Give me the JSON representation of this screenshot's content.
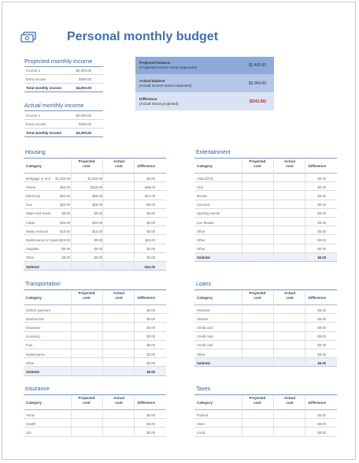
{
  "title": "Personal monthly budget",
  "projected_income": {
    "heading": "Projected monthly income",
    "rows": [
      {
        "label": "Income 1",
        "value": "$4,300.00"
      },
      {
        "label": "Extra income",
        "value": "$300.00"
      }
    ],
    "total": {
      "label": "Total monthly income",
      "value": "$4,600.00"
    }
  },
  "actual_income": {
    "heading": "Actual monthly income",
    "rows": [
      {
        "label": "Income 1",
        "value": "$4,000.00"
      },
      {
        "label": "Extra income",
        "value": "$300.00"
      }
    ],
    "total": {
      "label": "Total monthly income",
      "value": "$4,300.00"
    }
  },
  "summary": {
    "projected": {
      "label": "Projected balance",
      "sub": "(Projected income minus expenses)",
      "value": "$3,405.00"
    },
    "actual": {
      "label": "Actual balance",
      "sub": "(Actual income minus expenses)",
      "value": "$3,064.00"
    },
    "difference": {
      "label": "Difference",
      "sub": "(Actual minus projected)",
      "value": "($341.00)"
    },
    "colors": {
      "projected": "#8eaadb",
      "actual": "#b4c7e7",
      "difference": "#dae3f3",
      "negative": "#d12020"
    }
  },
  "table_headers": {
    "category": "Category",
    "projected": "Projected\ncost",
    "actual": "Actual\ncost",
    "difference": "Difference"
  },
  "subtotal_label": "Subtotal",
  "housing": {
    "title": "Housing",
    "rows": [
      {
        "cat": "Mortgage or rent",
        "proj": "$1,000.00",
        "act": "$1,000.00",
        "diff": "$0.00"
      },
      {
        "cat": "Phone",
        "proj": "$54.00",
        "act": "$100.00",
        "diff": "-$46.00"
      },
      {
        "cat": "Electricity",
        "proj": "$44.00",
        "act": "$56.00",
        "diff": "-$12.00"
      },
      {
        "cat": "Gas",
        "proj": "$22.00",
        "act": "$28.00",
        "diff": "-$6.00"
      },
      {
        "cat": "Water and sewer",
        "proj": "$8.00",
        "act": "$8.00",
        "diff": "$0.00"
      },
      {
        "cat": "Cable",
        "proj": "$34.00",
        "act": "$34.00",
        "diff": "$0.00"
      },
      {
        "cat": "Waste removal",
        "proj": "$10.00",
        "act": "$10.00",
        "diff": "$0.00"
      },
      {
        "cat": "Maintenance or repairs",
        "proj": "$23.00",
        "act": "$0.00",
        "diff": "$23.00"
      },
      {
        "cat": "Supplies",
        "proj": "$0.00",
        "act": "$0.00",
        "diff": "$0.00"
      },
      {
        "cat": "Other",
        "proj": "$0.00",
        "act": "$0.00",
        "diff": "$0.00"
      }
    ],
    "subtotal": "-$41.00"
  },
  "entertainment": {
    "title": "Entertainment",
    "rows": [
      {
        "cat": "Video/DVD",
        "proj": "",
        "act": "",
        "diff": "$0.00"
      },
      {
        "cat": "CDs",
        "proj": "",
        "act": "",
        "diff": "$0.00"
      },
      {
        "cat": "Movies",
        "proj": "",
        "act": "",
        "diff": "$0.00"
      },
      {
        "cat": "Concerts",
        "proj": "",
        "act": "",
        "diff": "$0.00"
      },
      {
        "cat": "Sporting events",
        "proj": "",
        "act": "",
        "diff": "$0.00"
      },
      {
        "cat": "Live theater",
        "proj": "",
        "act": "",
        "diff": "$0.00"
      },
      {
        "cat": "Other",
        "proj": "",
        "act": "",
        "diff": "$0.00"
      },
      {
        "cat": "Other",
        "proj": "",
        "act": "",
        "diff": "$0.00"
      },
      {
        "cat": "Other",
        "proj": "",
        "act": "",
        "diff": "$0.00"
      }
    ],
    "subtotal": "$0.00"
  },
  "transportation": {
    "title": "Transportation",
    "rows": [
      {
        "cat": "Vehicle payment",
        "proj": "",
        "act": "",
        "diff": "$0.00"
      },
      {
        "cat": "Bus/taxi fare",
        "proj": "",
        "act": "",
        "diff": "$0.00"
      },
      {
        "cat": "Insurance",
        "proj": "",
        "act": "",
        "diff": "$0.00"
      },
      {
        "cat": "Licensing",
        "proj": "",
        "act": "",
        "diff": "$0.00"
      },
      {
        "cat": "Fuel",
        "proj": "",
        "act": "",
        "diff": "$0.00"
      },
      {
        "cat": "Maintenance",
        "proj": "",
        "act": "",
        "diff": "$0.00"
      },
      {
        "cat": "Other",
        "proj": "",
        "act": "",
        "diff": "$0.00"
      }
    ],
    "subtotal": "$0.00"
  },
  "loans": {
    "title": "Loans",
    "rows": [
      {
        "cat": "Personal",
        "proj": "",
        "act": "",
        "diff": "$0.00"
      },
      {
        "cat": "Student",
        "proj": "",
        "act": "",
        "diff": "$0.00"
      },
      {
        "cat": "Credit card",
        "proj": "",
        "act": "",
        "diff": "$0.00"
      },
      {
        "cat": "Credit card",
        "proj": "",
        "act": "",
        "diff": "$0.00"
      },
      {
        "cat": "Credit card",
        "proj": "",
        "act": "",
        "diff": "$0.00"
      },
      {
        "cat": "Other",
        "proj": "",
        "act": "",
        "diff": "$0.00"
      }
    ],
    "subtotal": "$0.00"
  },
  "insurance": {
    "title": "Insurance",
    "rows": [
      {
        "cat": "Home",
        "proj": "",
        "act": "",
        "diff": "$0.00"
      },
      {
        "cat": "Health",
        "proj": "",
        "act": "",
        "diff": "$0.00"
      },
      {
        "cat": "Life",
        "proj": "",
        "act": "",
        "diff": "$0.00"
      }
    ]
  },
  "taxes": {
    "title": "Taxes",
    "rows": [
      {
        "cat": "Federal",
        "proj": "",
        "act": "",
        "diff": "$0.00"
      },
      {
        "cat": "State",
        "proj": "",
        "act": "",
        "diff": "$0.00"
      },
      {
        "cat": "Local",
        "proj": "",
        "act": "",
        "diff": "$0.00"
      }
    ]
  }
}
